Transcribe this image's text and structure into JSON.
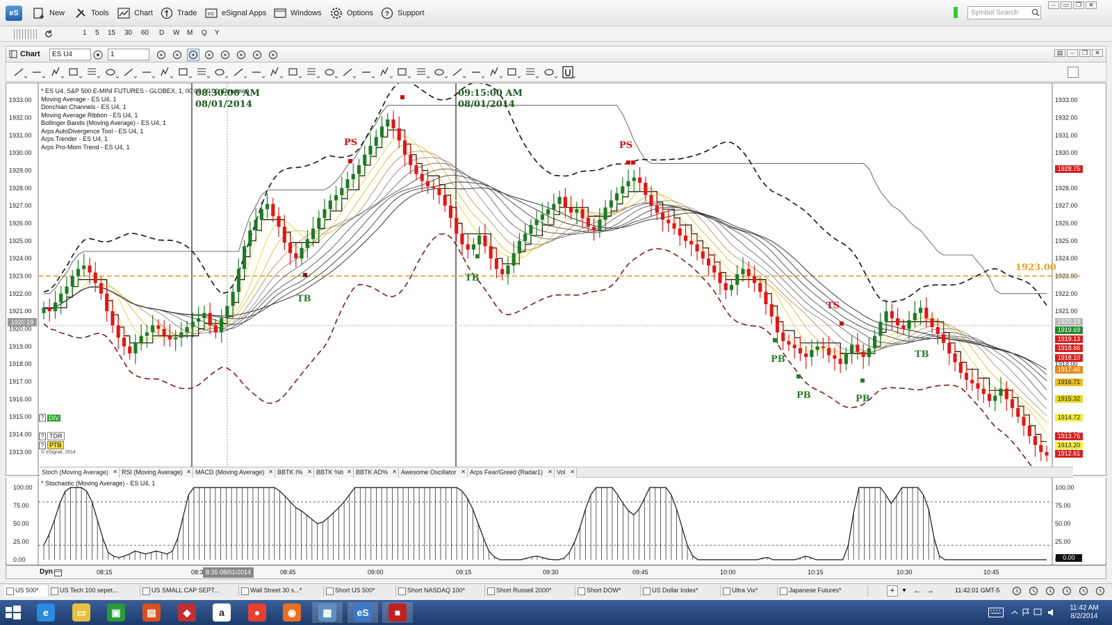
{
  "menubar": {
    "items": [
      {
        "label": "New",
        "icon": "new-chart-icon"
      },
      {
        "label": "Tools",
        "icon": "tools-icon"
      },
      {
        "label": "Chart",
        "icon": "chart-icon"
      },
      {
        "label": "Trade",
        "icon": "trade-icon"
      },
      {
        "label": "eSignal Apps",
        "icon": "apps-icon"
      },
      {
        "label": "Windows",
        "icon": "windows-icon"
      },
      {
        "label": "Options",
        "icon": "gear-icon"
      },
      {
        "label": "Support",
        "icon": "help-icon"
      }
    ],
    "logo": "eS",
    "search_placeholder": "Symbol Search"
  },
  "intervals": [
    "1",
    "5",
    "15",
    "30",
    "60",
    "D",
    "W",
    "M",
    "Q",
    "Y"
  ],
  "chart_window": {
    "title": "Chart",
    "symbol": "ES U4",
    "interval": "1"
  },
  "legend": {
    "lines": [
      "* ES U4, S&P 500 E-MINI FUTURES - GLOBEX, 1, 00:00-00:00 (Dynamic)",
      "Moving Average - ES U4, 1",
      "Donchian Channels - ES U4, 1",
      "Moving Average Ribbon - ES U4, 1",
      "Bollinger Bands (Moving Average) - ES U4, 1",
      "Arps AutoDivergence Tool - ES U4, 1",
      "Arps Trender - ES U4, 1",
      "Arps Pro-Mom Trend - ES U4, 1"
    ]
  },
  "markers": {
    "time1": "08:30:00 AM",
    "date1": "08/01/2014",
    "time2": "09:15:00 AM",
    "date2": "08/01/2014",
    "hline_label": "1923.00",
    "crosshair_price": "1920.19"
  },
  "annotations": [
    {
      "text": "PS",
      "color": "#cc1111"
    },
    {
      "text": "PS",
      "color": "#cc1111"
    },
    {
      "text": "TB",
      "color": "#2a7a2a"
    },
    {
      "text": "TB",
      "color": "#2a7a2a"
    },
    {
      "text": "TB",
      "color": "#2a7a2a"
    },
    {
      "text": "TS",
      "color": "#cc1111"
    },
    {
      "text": "PB",
      "color": "#2a7a2a"
    },
    {
      "text": "PB",
      "color": "#2a7a2a"
    },
    {
      "text": "PB",
      "color": "#2a7a2a"
    }
  ],
  "left_badges": {
    "div": "DIV",
    "tdr": "TDR",
    "ptb": "PTB",
    "copyright": "© eSignal, 2014"
  },
  "right_badges": [
    {
      "text": "1928.75",
      "bg": "#d42020",
      "fg": "#ffffff"
    },
    {
      "text": "1920.19",
      "bg": "#b8b8b8",
      "fg": "#ffffff"
    },
    {
      "text": "1919.69",
      "bg": "#1f8a2a",
      "fg": "#ffffff"
    },
    {
      "text": "1919.13",
      "bg": "#d42020",
      "fg": "#ffffff"
    },
    {
      "text": "1918.66",
      "bg": "#d42020",
      "fg": "#ffffff"
    },
    {
      "text": "1918.10",
      "bg": "#d42020",
      "fg": "#ffffff"
    },
    {
      "text": "1917.46",
      "bg": "#e88a20",
      "fg": "#ffffff"
    },
    {
      "text": "1916.71",
      "bg": "#e8c020",
      "fg": "#222222"
    },
    {
      "text": "1915.32",
      "bg": "#e8d820",
      "fg": "#222222"
    },
    {
      "text": "1914.72",
      "bg": "#f0ee40",
      "fg": "#222222"
    },
    {
      "text": "1913.76",
      "bg": "#d42020",
      "fg": "#ffffff"
    },
    {
      "text": "1913.20",
      "bg": "#f0ee40",
      "fg": "#222222"
    },
    {
      "text": "1912.61",
      "bg": "#d42020",
      "fg": "#ffffff"
    }
  ],
  "study_tabs": [
    "Stoch (Moving Average)",
    "RSI (Moving Average)",
    "MACD (Moving Average)",
    "BBTK I%",
    "BBTK %b",
    "BBTK AD%",
    "Awesome Oscillator",
    "Arps Fear/Greed (Radar1)",
    "Vol"
  ],
  "stoch": {
    "label": "* Stochastic (Moving Average) - ES U4, 1",
    "current": "0.00"
  },
  "time_axis": {
    "dyn": "Dyn",
    "crosshair_label": "8:35 08/01/2014"
  },
  "page_tabs": [
    "US 500*",
    "US Tech 100 sepet...",
    "US SMALL CAP SEPT...",
    "Wall Street 30 s...*",
    "Short US 500*",
    "Short NASDAQ 100*",
    "Short Russell 2000*",
    "Short DOW*",
    "US Dollar Index*",
    "Ultra Vix*",
    "Japanese Futures*"
  ],
  "status": {
    "clock": "11:42:01 GMT-5"
  },
  "taskbar": {
    "time": "11:42 AM",
    "date": "8/2/2014"
  },
  "chart_data": {
    "type": "candlestick",
    "y_ticks": [
      "1933.00",
      "1932.00",
      "1931.00",
      "1930.00",
      "1929.00",
      "1928.00",
      "1927.00",
      "1926.00",
      "1925.00",
      "1924.00",
      "1923.00",
      "1922.00",
      "1921.00",
      "1920.00",
      "1919.00",
      "1918.00",
      "1917.00",
      "1916.00",
      "1915.00",
      "1914.00",
      "1913.00"
    ],
    "y_range": [
      1912.6,
      1933.4
    ],
    "x_ticks": [
      "08:15",
      "08:30",
      "08:45",
      "09:00",
      "09:15",
      "09:30",
      "09:45",
      "10:00",
      "10:15",
      "10:30",
      "10:45"
    ],
    "close": [
      1921.2,
      1921.0,
      1921.5,
      1922.0,
      1922.4,
      1923.0,
      1923.4,
      1923.6,
      1923.2,
      1922.6,
      1922.0,
      1921.0,
      1920.2,
      1919.5,
      1919.0,
      1918.6,
      1919.2,
      1919.6,
      1919.8,
      1920.2,
      1920.0,
      1919.6,
      1919.4,
      1919.5,
      1919.8,
      1920.1,
      1920.4,
      1920.6,
      1920.9,
      1920.2,
      1919.8,
      1920.6,
      1921.3,
      1922.1,
      1923.4,
      1924.7,
      1925.6,
      1926.2,
      1926.8,
      1927.1,
      1926.4,
      1925.8,
      1924.9,
      1924.3,
      1924.0,
      1924.6,
      1925.1,
      1925.7,
      1926.3,
      1926.8,
      1927.3,
      1927.6,
      1928.0,
      1928.5,
      1928.8,
      1929.3,
      1929.9,
      1930.4,
      1930.9,
      1931.5,
      1931.9,
      1931.4,
      1930.7,
      1929.9,
      1929.3,
      1928.8,
      1928.4,
      1928.1,
      1928.0,
      1927.6,
      1927.0,
      1926.3,
      1925.4,
      1924.8,
      1924.5,
      1924.8,
      1925.3,
      1924.7,
      1924.0,
      1923.4,
      1923.1,
      1923.6,
      1924.3,
      1925.0,
      1925.4,
      1925.9,
      1926.2,
      1926.5,
      1926.8,
      1927.1,
      1927.5,
      1926.9,
      1926.6,
      1926.8,
      1926.3,
      1925.8,
      1925.6,
      1926.2,
      1926.9,
      1927.3,
      1927.7,
      1928.1,
      1928.4,
      1928.6,
      1928.3,
      1927.6,
      1927.0,
      1926.6,
      1926.2,
      1926.0,
      1925.7,
      1925.3,
      1925.0,
      1924.8,
      1924.4,
      1924.0,
      1923.6,
      1923.2,
      1922.6,
      1922.2,
      1922.5,
      1923.1,
      1923.4,
      1923.0,
      1922.6,
      1922.1,
      1921.4,
      1920.7,
      1919.8,
      1919.3,
      1919.1,
      1918.9,
      1918.6,
      1918.4,
      1918.8,
      1919.0,
      1918.9,
      1918.5,
      1918.3,
      1918.0,
      1918.6,
      1919.1,
      1918.7,
      1918.4,
      1918.9,
      1919.6,
      1920.4,
      1921.0,
      1920.6,
      1920.2,
      1920.0,
      1920.5,
      1920.9,
      1921.2,
      1920.6,
      1920.1,
      1919.7,
      1919.2,
      1918.6,
      1918.1,
      1917.5,
      1917.1,
      1916.9,
      1916.6,
      1916.3,
      1915.9,
      1916.2,
      1916.6,
      1916.0,
      1915.5,
      1915.0,
      1914.5,
      1913.9,
      1913.4,
      1913.0,
      1912.8
    ]
  },
  "stoch_data": {
    "y_ticks": [
      "100.00",
      "75.00",
      "50.00",
      "25.00",
      "0.00"
    ],
    "values": [
      20,
      35,
      55,
      78,
      95,
      100,
      100,
      100,
      95,
      80,
      55,
      30,
      10,
      5,
      3,
      5,
      8,
      12,
      10,
      8,
      10,
      12,
      10,
      8,
      12,
      30,
      60,
      90,
      100,
      100,
      100,
      100,
      100,
      100,
      100,
      100,
      100,
      100,
      100,
      100,
      100,
      100,
      100,
      100,
      95,
      88,
      80,
      72,
      68,
      62,
      56,
      50,
      52,
      58,
      65,
      72,
      80,
      90,
      100,
      100,
      100,
      100,
      100,
      100,
      100,
      100,
      100,
      100,
      100,
      100,
      100,
      100,
      100,
      100,
      100,
      100,
      100,
      100,
      95,
      85,
      70,
      50,
      30,
      12,
      4,
      0,
      0,
      0,
      0,
      0,
      2,
      4,
      5,
      3,
      1,
      0,
      0,
      2,
      10,
      25,
      45,
      70,
      90,
      100,
      100,
      100,
      100,
      90,
      78,
      68,
      62,
      70,
      85,
      100,
      100,
      100,
      100,
      90,
      70,
      45,
      20,
      5,
      0,
      0,
      0,
      0,
      0,
      0,
      0,
      0,
      0,
      0,
      0,
      0,
      2,
      3,
      0,
      0,
      0,
      0,
      0,
      2,
      5,
      3,
      0,
      0,
      0,
      0,
      0,
      0,
      20,
      65,
      100,
      100,
      100,
      100,
      100,
      90,
      78,
      88,
      100,
      100,
      100,
      100,
      90,
      70,
      30,
      5,
      0,
      0,
      0,
      0,
      0,
      0,
      0,
      0,
      0,
      0,
      0,
      0,
      0,
      0,
      0,
      0,
      0,
      0,
      0,
      0
    ]
  }
}
